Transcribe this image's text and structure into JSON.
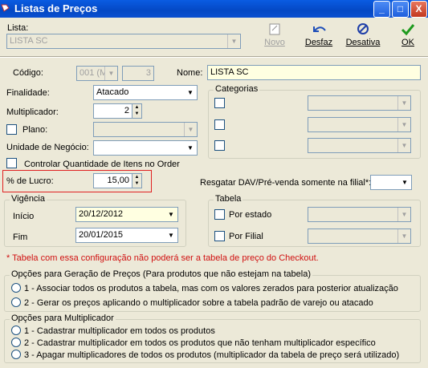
{
  "window": {
    "title": "Listas de Preços",
    "controls": [
      "_",
      "□",
      "X"
    ]
  },
  "header": {
    "lista_label": "Lista:",
    "lista_value": "LISTA SC",
    "toolbar": {
      "novo": "Novo",
      "desfaz": "Desfaz",
      "desativa": "Desativa",
      "ok": "OK"
    }
  },
  "form": {
    "codigo_label": "Código:",
    "codigo_value": "001 (M",
    "codigo_num": "3",
    "nome_label": "Nome:",
    "nome_value": "LISTA SC",
    "finalidade_label": "Finalidade:",
    "finalidade_value": "Atacado",
    "multiplicador_label": "Multiplicador:",
    "multiplicador_value": "2",
    "plano_label": "Plano:",
    "unidade_label": "Unidade de Negócio:",
    "controlar_label": "Controlar Quantidade de Itens no Order",
    "lucro_label": "% de Lucro:",
    "lucro_value": "15,00",
    "categorias_title": "Categorias",
    "resgatar_label": "Resgatar DAV/Pré-venda somente na filial*:",
    "vigencia_title": "Vigência",
    "inicio_label": "Início",
    "inicio_value": "20/12/2012",
    "fim_label": "Fim",
    "fim_value": "20/01/2015",
    "tabela_title": "Tabela",
    "por_estado_label": "Por estado",
    "por_filial_label": "Por Filial",
    "warning": "* Tabela com essa configuração não poderá ser a tabela de preço do Checkout."
  },
  "opcoes_geracao": {
    "title": "Opções para Geração de Preços (Para produtos que não estejam na tabela)",
    "options": [
      "1 - Associar todos os produtos a tabela, mas com os valores zerados para posterior atualização",
      "2 - Gerar os preços aplicando o multiplicador sobre a tabela padrão de varejo ou atacado"
    ]
  },
  "opcoes_multiplicador": {
    "title": "Opções para Multiplicador",
    "options": [
      "1 - Cadastrar multiplicador em todos os produtos",
      "2 - Cadastrar multiplicador em todos os produtos que não tenham multiplicador específico",
      "3 - Apagar multiplicadores de todos os produtos (multiplicador da tabela de preço será utilizado)"
    ]
  },
  "colors": {
    "titlebar": "#0448C4",
    "warning_red": "#D01010",
    "highlight_box": "#E02020",
    "yellow_field": "#FFFFE1"
  }
}
